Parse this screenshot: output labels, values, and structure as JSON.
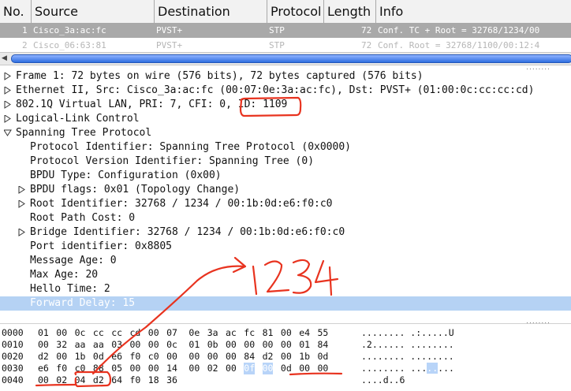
{
  "packet_list": {
    "columns": [
      "No.",
      "Source",
      "Destination",
      "Protocol",
      "Length",
      "Info"
    ],
    "rows": [
      {
        "no": "1",
        "source": "Cisco_3a:ac:fc",
        "destination": "PVST+",
        "protocol": "STP",
        "length": "72",
        "info": "Conf. TC + Root = 32768/1234/00"
      },
      {
        "no": "2",
        "source": "Cisco_06:63:81",
        "destination": "PVST+",
        "protocol": "STP",
        "length": "72",
        "info": "Conf. Root = 32768/1100/00:12:4"
      }
    ]
  },
  "details": [
    {
      "text": "Frame 1: 72 bytes on wire (576 bits), 72 bytes captured (576 bits)",
      "expander": "collapsed",
      "indent": 0
    },
    {
      "text": "Ethernet II, Src: Cisco_3a:ac:fc (00:07:0e:3a:ac:fc), Dst: PVST+ (01:00:0c:cc:cc:cd)",
      "expander": "collapsed",
      "indent": 0
    },
    {
      "text": "802.1Q Virtual LAN, PRI: 7, CFI: 0, ID: 1109",
      "expander": "collapsed",
      "indent": 0
    },
    {
      "text": "Logical-Link Control",
      "expander": "collapsed",
      "indent": 0
    },
    {
      "text": "Spanning Tree Protocol",
      "expander": "expanded",
      "indent": 0
    },
    {
      "text": "Protocol Identifier: Spanning Tree Protocol (0x0000)",
      "expander": "none",
      "indent": 1
    },
    {
      "text": "Protocol Version Identifier: Spanning Tree (0)",
      "expander": "none",
      "indent": 1
    },
    {
      "text": "BPDU Type: Configuration (0x00)",
      "expander": "none",
      "indent": 1
    },
    {
      "text": "BPDU flags: 0x01 (Topology Change)",
      "expander": "collapsed",
      "indent": 1
    },
    {
      "text": "Root Identifier: 32768 / 1234 / 00:1b:0d:e6:f0:c0",
      "expander": "collapsed",
      "indent": 1
    },
    {
      "text": "Root Path Cost: 0",
      "expander": "none",
      "indent": 1
    },
    {
      "text": "Bridge Identifier: 32768 / 1234 / 00:1b:0d:e6:f0:c0",
      "expander": "collapsed",
      "indent": 1
    },
    {
      "text": "Port identifier: 0x8805",
      "expander": "none",
      "indent": 1
    },
    {
      "text": "Message Age: 0",
      "expander": "none",
      "indent": 1
    },
    {
      "text": "Max Age: 20",
      "expander": "none",
      "indent": 1
    },
    {
      "text": "Hello Time: 2",
      "expander": "none",
      "indent": 1
    },
    {
      "text": "Forward Delay: 15",
      "expander": "none",
      "indent": 1,
      "selected": true
    }
  ],
  "bytes": [
    {
      "offset": "0000",
      "hex": [
        "01",
        "00",
        "0c",
        "cc",
        "cc",
        "cd",
        "00",
        "07",
        "0e",
        "3a",
        "ac",
        "fc",
        "81",
        "00",
        "e4",
        "55"
      ],
      "ascii": "........ .:.....U"
    },
    {
      "offset": "0010",
      "hex": [
        "00",
        "32",
        "aa",
        "aa",
        "03",
        "00",
        "00",
        "0c",
        "01",
        "0b",
        "00",
        "00",
        "00",
        "00",
        "01",
        "84"
      ],
      "ascii": ".2...... ........"
    },
    {
      "offset": "0020",
      "hex": [
        "d2",
        "00",
        "1b",
        "0d",
        "e6",
        "f0",
        "c0",
        "00",
        "00",
        "00",
        "00",
        "84",
        "d2",
        "00",
        "1b",
        "0d"
      ],
      "ascii": "........ ........"
    },
    {
      "offset": "0030",
      "hex": [
        "e6",
        "f0",
        "c0",
        "88",
        "05",
        "00",
        "00",
        "14",
        "00",
        "02",
        "00",
        "0f",
        "00",
        "0d",
        "00",
        "00"
      ],
      "ascii": "........ ........"
    },
    {
      "offset": "0040",
      "hex": [
        "00",
        "02",
        "04",
        "d2",
        "64",
        "f0",
        "18",
        "36"
      ],
      "ascii": "....d..6"
    }
  ],
  "annotation": {
    "handwritten_text": "1234",
    "color": "#e8331f"
  }
}
